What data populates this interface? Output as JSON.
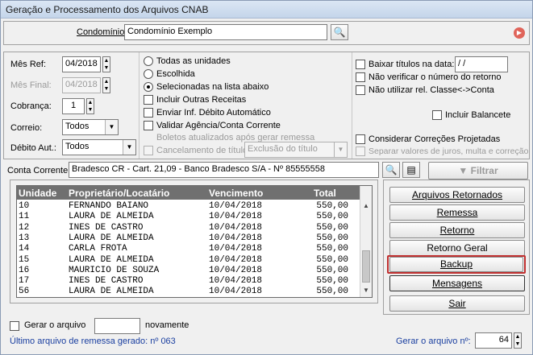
{
  "window": {
    "title": "Geração e Processamento dos Arquivos CNAB"
  },
  "condominio": {
    "label": "Condomínio:",
    "value": "Condomínio Exemplo"
  },
  "filters": {
    "mes_ref_label": "Mês Ref:",
    "mes_ref_value": "04/2018",
    "mes_final_label": "Mês Final:",
    "mes_final_value": "04/2018",
    "cobranca_label": "Cobrança:",
    "cobranca_value": "1",
    "correio_label": "Correio:",
    "correio_value": "Todos",
    "debito_label": "Débito Aut.:",
    "debito_value": "Todos"
  },
  "units": {
    "todas": "Todas as unidades",
    "escolhida": "Escolhida",
    "selecionadas": "Selecionadas na lista abaixo",
    "selected": "selecionadas"
  },
  "options_mid": {
    "incluir_outras": "Incluir Outras Receitas",
    "enviar_debito": "Enviar Inf. Débito Automático",
    "validar_agencia": "Validar Agência/Conta Corrente",
    "boletos_atualizados": "Boletos atualizados após gerar remessa",
    "cancelamento": "Cancelamento de título",
    "exclusao_value": "Exclusão do título"
  },
  "options_right": {
    "baixar_titulos": "Baixar títulos na data:",
    "baixar_date": " / /",
    "nao_verificar": "Não verificar o número do retorno",
    "nao_utilizar": "Não utilizar rel. Classe<->Conta",
    "incluir_balancete": "Incluir Balancete",
    "considerar_correcoes": "Considerar Correções Projetadas",
    "separar_valores": "Separar valores de juros, multa e correção"
  },
  "conta": {
    "label": "Conta Corrente:",
    "value": "Bradesco CR - Cart. 21,09 - Banco Bradesco S/A - Nº 85555558",
    "filtrar": "Filtrar"
  },
  "grid": {
    "headers": [
      "Unidade",
      "Proprietário/Locatário",
      "Vencimento",
      "Total"
    ],
    "rows": [
      [
        "10",
        "FERNANDO BAIANO",
        "10/04/2018",
        "550,00"
      ],
      [
        "11",
        "LAURA DE ALMEIDA",
        "10/04/2018",
        "550,00"
      ],
      [
        "12",
        "INES DE CASTRO",
        "10/04/2018",
        "550,00"
      ],
      [
        "13",
        "LAURA DE ALMEIDA",
        "10/04/2018",
        "550,00"
      ],
      [
        "14",
        "CARLA FROTA",
        "10/04/2018",
        "550,00"
      ],
      [
        "15",
        "LAURA DE ALMEIDA",
        "10/04/2018",
        "550,00"
      ],
      [
        "16",
        "MAURICIO DE SOUZA",
        "10/04/2018",
        "550,00"
      ],
      [
        "17",
        "INES DE CASTRO",
        "10/04/2018",
        "550,00"
      ],
      [
        "56",
        "LAURA DE ALMEIDA",
        "10/04/2018",
        "550,00"
      ]
    ]
  },
  "actions": {
    "arquivos_retornados": "Arquivos Retornados",
    "remessa": "Remessa",
    "retorno": "Retorno",
    "retorno_geral": "Retorno Geral",
    "backup": "Backup",
    "mensagens": "Mensagens",
    "sair": "Sair"
  },
  "footer": {
    "gerar_arquivo": "Gerar o arquivo",
    "novamente": "novamente",
    "ultimo_arquivo": "Último arquivo de remessa gerado: nº 063",
    "gerar_numero_label": "Gerar o arquivo nº:",
    "gerar_numero_value": "64"
  },
  "colors": {
    "grid_header": "#707070",
    "highlight_border": "#c03030",
    "ultimo_text": "#1a3fa0"
  }
}
